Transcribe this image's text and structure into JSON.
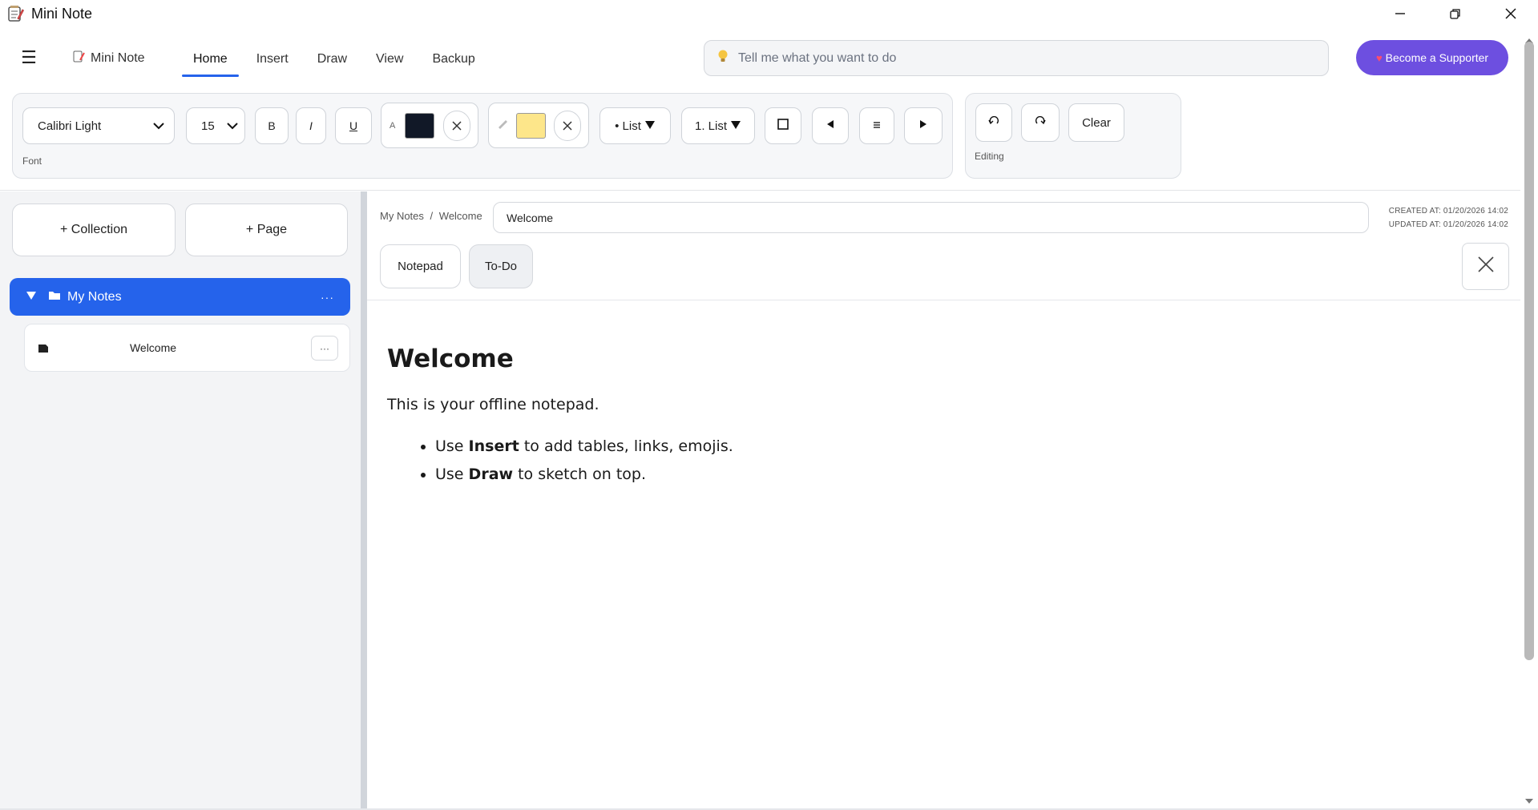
{
  "window": {
    "title": "Mini Note",
    "icon": "notepad-icon",
    "controls": [
      "minimize-icon",
      "restore-icon",
      "close-icon"
    ]
  },
  "nav": {
    "menu_icon": "hamburger-icon",
    "brand": "Mini Note",
    "tabs": [
      "Home",
      "Insert",
      "Draw",
      "View",
      "Backup"
    ],
    "active_tab": "Home",
    "search_placeholder": "Tell me what you want to do",
    "supporter_label": "Become a Supporter",
    "accent": "#2563eb",
    "supporter_color": "#6d4fe0"
  },
  "ribbon": {
    "font_name": "Calibri Light",
    "font_size": "15",
    "bold": "B",
    "italic": "I",
    "underline": "U",
    "text_color_label": "A",
    "text_color": "#111827",
    "highlight_color": "#fde68a",
    "bullet_list": "• List",
    "numbered_list": "1. List",
    "font_group_label": "Font",
    "clear_label": "Clear",
    "editing_group_label": "Editing"
  },
  "sidebar": {
    "add_collection": "+ Collection",
    "add_page": "+ Page",
    "collection_name": "My Notes",
    "more": "···",
    "pages": [
      {
        "title": "Welcome"
      }
    ]
  },
  "note": {
    "breadcrumb_root": "My Notes",
    "breadcrumb_sep": "/",
    "breadcrumb_page": "Welcome",
    "title": "Welcome",
    "created": "CREATED AT: 01/20/2026 14:02",
    "updated": "UPDATED AT: 01/20/2026 14:02",
    "tabs": [
      "Notepad",
      "To-Do"
    ],
    "heading": "Welcome",
    "paragraph": "This is your offline notepad.",
    "bullets": [
      {
        "pre": "Use ",
        "bold": "Insert",
        "post": " to add tables, links, emojis."
      },
      {
        "pre": "Use ",
        "bold": "Draw",
        "post": " to sketch on top."
      }
    ]
  }
}
